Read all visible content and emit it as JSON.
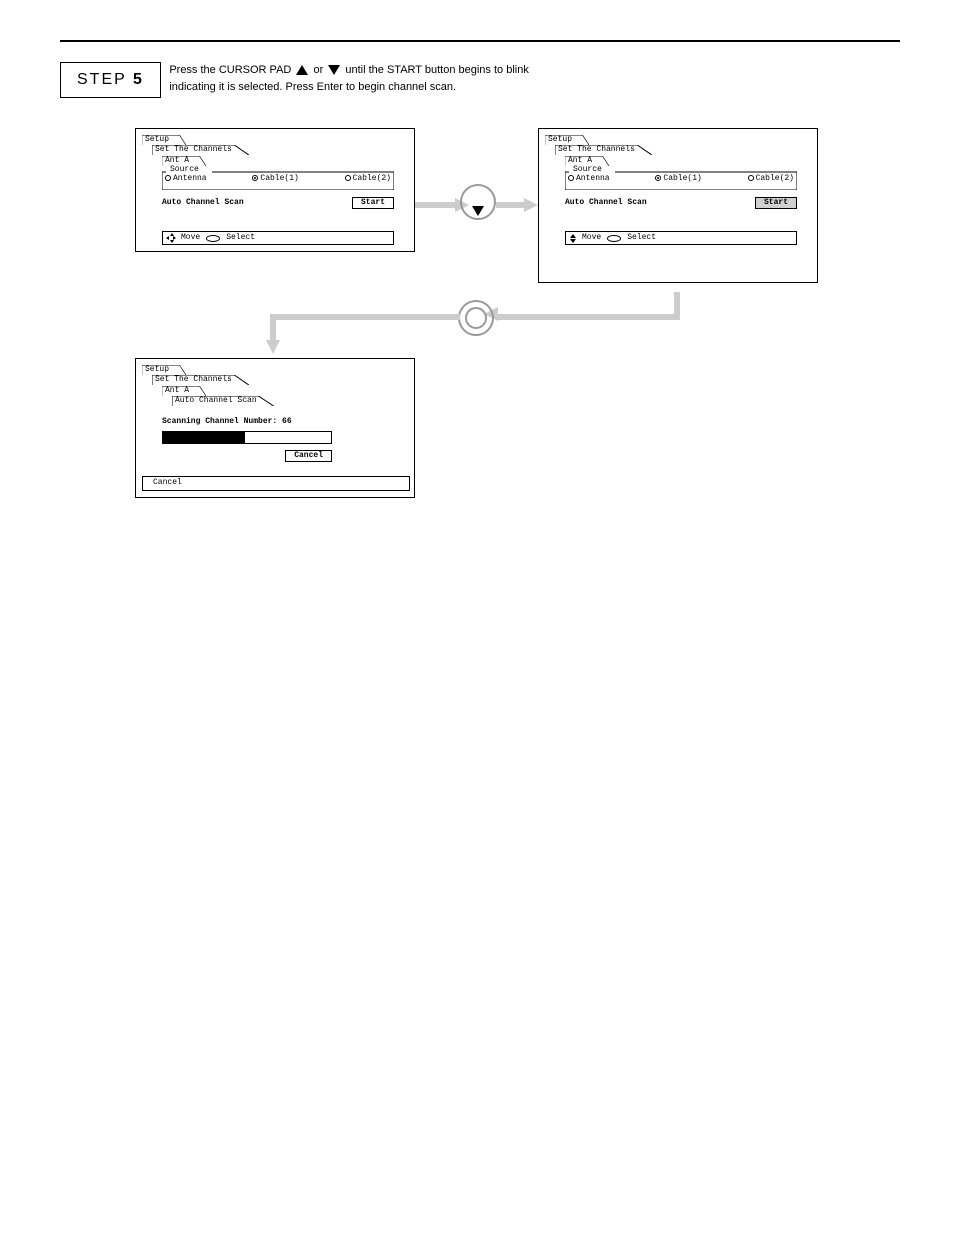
{
  "step": {
    "label": "STEP",
    "num": "5"
  },
  "instruction": {
    "line1_pre": "Press the CURSOR PAD ",
    "line1_mid": " or ",
    "line1_post": " until the START button begins to blink",
    "line2": "indicating it is selected. Press Enter to begin channel scan."
  },
  "panelA": {
    "tabs": [
      "Setup",
      "Set The Channels",
      "Ant A"
    ],
    "source_label": "Source",
    "opts": [
      {
        "label": "Antenna",
        "sel": false
      },
      {
        "label": "Cable(1)",
        "sel": true
      },
      {
        "label": "Cable(2)",
        "sel": false
      }
    ],
    "scan_label": "Auto Channel Scan",
    "start": "Start",
    "help_move": "Move",
    "help_select": "Select"
  },
  "panelB": {
    "tabs": [
      "Setup",
      "Set The Channels",
      "Ant A"
    ],
    "source_label": "Source",
    "opts": [
      {
        "label": "Antenna",
        "sel": false
      },
      {
        "label": "Cable(1)",
        "sel": true
      },
      {
        "label": "Cable(2)",
        "sel": false
      }
    ],
    "scan_label": "Auto Channel Scan",
    "start": "Start",
    "help_move": "Move",
    "help_select": "Select"
  },
  "panelC": {
    "tabs": [
      "Setup",
      "Set The Channels",
      "Ant A",
      "Auto Channel Scan"
    ],
    "scan_text": "Scanning Channel Number: 66",
    "cancel": "Cancel",
    "help_cancel": "Cancel"
  }
}
